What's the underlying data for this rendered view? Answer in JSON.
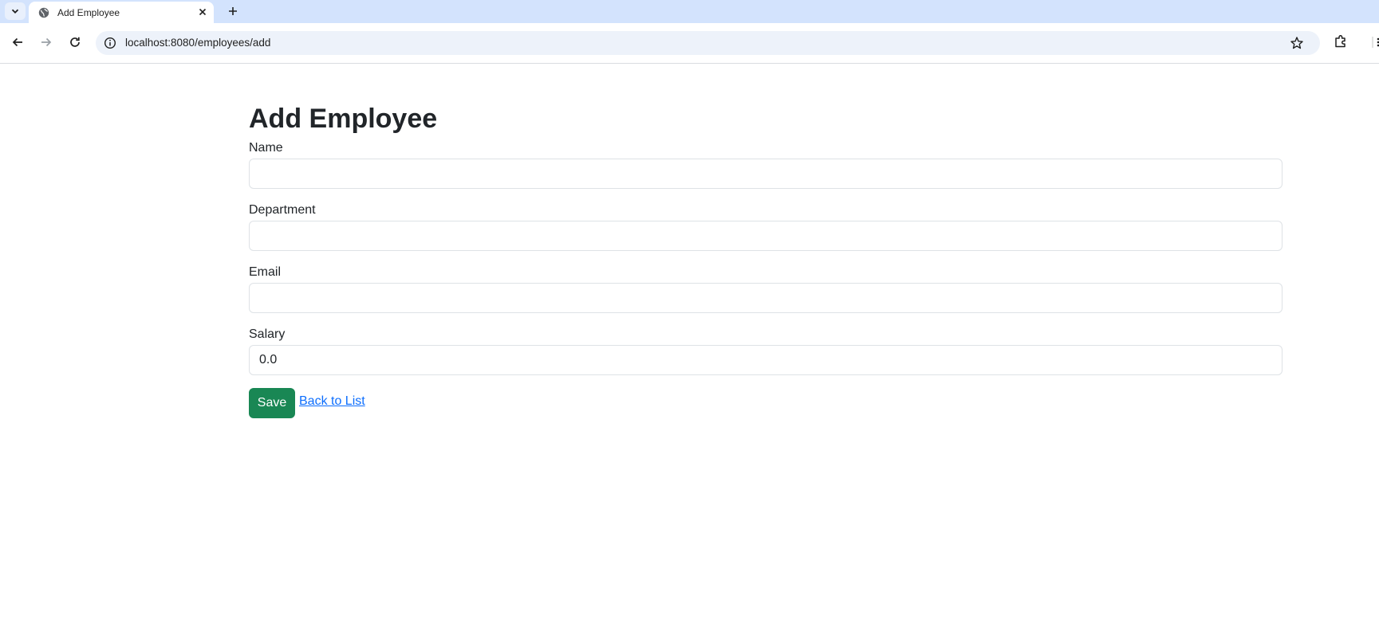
{
  "browser": {
    "tab_title": "Add Employee",
    "url": "localhost:8080/employees/add"
  },
  "page": {
    "title": "Add Employee",
    "fields": [
      {
        "label": "Name",
        "value": ""
      },
      {
        "label": "Department",
        "value": ""
      },
      {
        "label": "Email",
        "value": ""
      },
      {
        "label": "Salary",
        "value": "0.0"
      }
    ],
    "save_label": "Save",
    "back_label": "Back to List"
  },
  "colors": {
    "tabbar_bg": "#d3e3fd",
    "omnibox_bg": "#edf2fa",
    "save_button": "#198754",
    "link": "#0d6efd",
    "text": "#212529"
  },
  "icons": [
    "tab-search-icon",
    "globe-icon",
    "close-icon",
    "plus-icon",
    "back-arrow-icon",
    "forward-arrow-icon",
    "reload-icon",
    "info-icon",
    "star-icon",
    "extensions-icon",
    "menu-icon"
  ]
}
